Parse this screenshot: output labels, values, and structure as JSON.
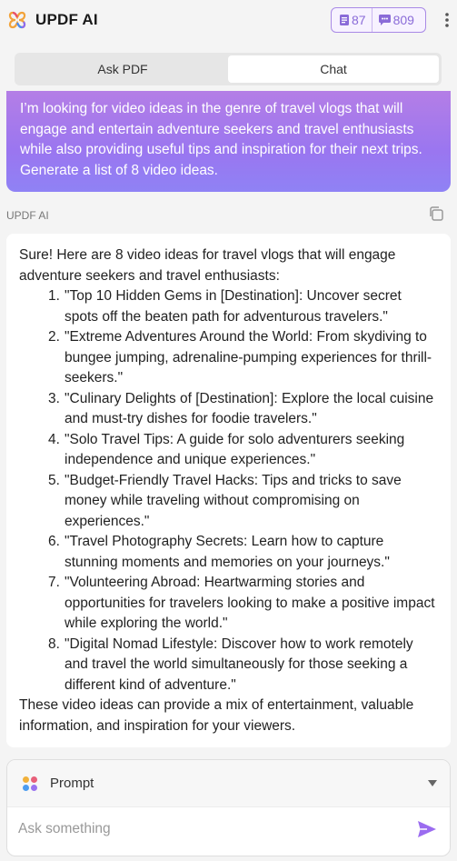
{
  "header": {
    "app_title": "UPDF AI",
    "quota_docs": "87",
    "quota_chats": "809",
    "accent": "#8a6bd8",
    "logo_icon": "updf-logo-icon",
    "more_icon": "more-vertical-icon"
  },
  "tabs": [
    {
      "label": "Ask PDF",
      "active": false
    },
    {
      "label": "Chat",
      "active": true
    }
  ],
  "user_message": "I’m looking for video ideas in the genre of travel vlogs that will engage and entertain adventure seekers and travel enthusiasts while also providing useful tips and inspiration for their next trips. Generate a list of 8 video ideas.",
  "ai": {
    "label": "UPDF AI",
    "intro": "Sure! Here are 8 video ideas for travel vlogs that will engage adventure seekers and travel enthusiasts:",
    "items": [
      {
        "num": "1.",
        "text": "\"Top 10 Hidden Gems in [Destination]: Uncover secret spots off the beaten path for adventurous travelers.\""
      },
      {
        "num": "2.",
        "text": "\"Extreme Adventures Around the World: From skydiving to bungee jumping, adrenaline-pumping experiences for thrill-seekers.\""
      },
      {
        "num": "3.",
        "text": "\"Culinary Delights of [Destination]: Explore the local cuisine and must-try dishes for foodie travelers.\""
      },
      {
        "num": "4.",
        "text": "\"Solo Travel Tips: A guide for solo adventurers seeking independence and unique experiences.\""
      },
      {
        "num": "5.",
        "text": "\"Budget-Friendly Travel Hacks: Tips and tricks to save money while traveling without compromising on experiences.\""
      },
      {
        "num": "6.",
        "text": "\"Travel Photography Secrets: Learn how to capture stunning moments and memories on your journeys.\""
      },
      {
        "num": "7.",
        "text": "\"Volunteering Abroad: Heartwarming stories and opportunities for travelers looking to make a positive impact while exploring the world.\""
      },
      {
        "num": "8.",
        "text": "\"Digital Nomad Lifestyle: Discover how to work remotely and travel the world simultaneously for those seeking a different kind of adventure.\""
      }
    ],
    "outro": "These video ideas can provide a mix of entertainment, valuable information, and inspiration for your viewers."
  },
  "composer": {
    "prompt_label": "Prompt",
    "placeholder": "Ask something",
    "send_color": "#9b6cf0"
  }
}
